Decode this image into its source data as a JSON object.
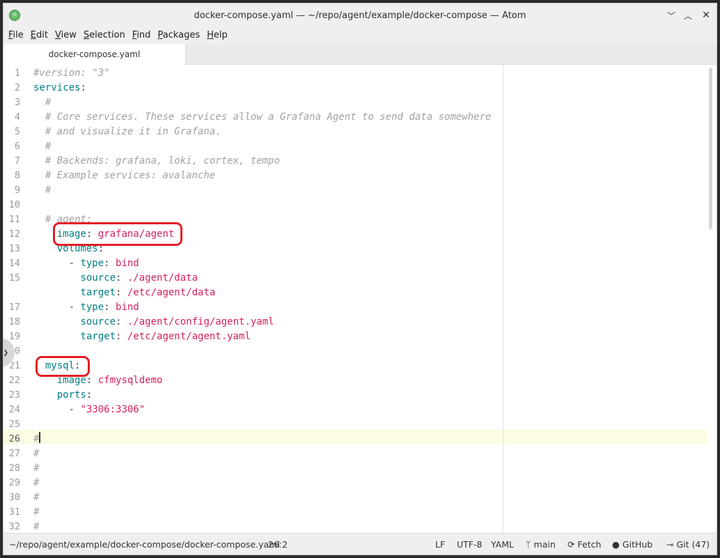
{
  "window": {
    "title": "docker-compose.yaml — ~/repo/agent/example/docker-compose — Atom"
  },
  "menu": [
    {
      "label": "File",
      "mnemonic": "F",
      "rest": "ile"
    },
    {
      "label": "Edit",
      "mnemonic": "E",
      "rest": "dit"
    },
    {
      "label": "View",
      "mnemonic": "V",
      "rest": "iew"
    },
    {
      "label": "Selection",
      "mnemonic": "S",
      "rest": "election"
    },
    {
      "label": "Find",
      "mnemonic": "F",
      "rest": "ind"
    },
    {
      "label": "Packages",
      "mnemonic": "P",
      "rest": "ackages"
    },
    {
      "label": "Help",
      "mnemonic": "H",
      "rest": "elp"
    }
  ],
  "tabs": [
    {
      "label": "docker-compose.yaml",
      "active": true
    }
  ],
  "editor": {
    "active_line": 26,
    "lines": [
      {
        "n": "1",
        "tokens": [
          {
            "t": "comment",
            "v": "#version: \"3\""
          }
        ]
      },
      {
        "n": "2",
        "tokens": [
          {
            "t": "key",
            "v": "services"
          },
          {
            "t": "punct",
            "v": ":"
          }
        ]
      },
      {
        "n": "3",
        "tokens": [
          {
            "t": "comment",
            "v": "  #"
          }
        ]
      },
      {
        "n": "4",
        "tokens": [
          {
            "t": "comment",
            "v": "  # Core services. These services allow a Grafana Agent to send data somewhere"
          }
        ]
      },
      {
        "n": "5",
        "tokens": [
          {
            "t": "comment",
            "v": "  # and visualize it in Grafana."
          }
        ]
      },
      {
        "n": "6",
        "tokens": [
          {
            "t": "comment",
            "v": "  #"
          }
        ]
      },
      {
        "n": "7",
        "tokens": [
          {
            "t": "comment",
            "v": "  # Backends: grafana, loki, cortex, tempo"
          }
        ]
      },
      {
        "n": "8",
        "tokens": [
          {
            "t": "comment",
            "v": "  # Example services: avalanche"
          }
        ]
      },
      {
        "n": "9",
        "tokens": [
          {
            "t": "comment",
            "v": "  #"
          }
        ]
      },
      {
        "n": "10",
        "tokens": []
      },
      {
        "n": "11",
        "tokens": [
          {
            "t": "comment",
            "v": "  # agent:"
          }
        ]
      },
      {
        "n": "12",
        "tokens": [
          {
            "t": "plain",
            "v": "    "
          },
          {
            "t": "key",
            "v": "image"
          },
          {
            "t": "punct",
            "v": ": "
          },
          {
            "t": "str",
            "v": "grafana/agent"
          }
        ]
      },
      {
        "n": "13",
        "tokens": [
          {
            "t": "plain",
            "v": "    "
          },
          {
            "t": "key",
            "v": "volumes"
          },
          {
            "t": "punct",
            "v": ":"
          }
        ]
      },
      {
        "n": "14",
        "tokens": [
          {
            "t": "plain",
            "v": "      - "
          },
          {
            "t": "key",
            "v": "type"
          },
          {
            "t": "punct",
            "v": ": "
          },
          {
            "t": "str",
            "v": "bind"
          }
        ]
      },
      {
        "n": "15",
        "tokens": [
          {
            "t": "plain",
            "v": "        "
          },
          {
            "t": "key",
            "v": "source"
          },
          {
            "t": "punct",
            "v": ": "
          },
          {
            "t": "str",
            "v": "./agent/data"
          }
        ]
      },
      {
        "n": "",
        "tokens": [
          {
            "t": "plain",
            "v": "        "
          },
          {
            "t": "key",
            "v": "target"
          },
          {
            "t": "punct",
            "v": ": "
          },
          {
            "t": "str",
            "v": "/etc/agent/data"
          }
        ]
      },
      {
        "n": "17",
        "tokens": [
          {
            "t": "plain",
            "v": "      - "
          },
          {
            "t": "key",
            "v": "type"
          },
          {
            "t": "punct",
            "v": ": "
          },
          {
            "t": "str",
            "v": "bind"
          }
        ]
      },
      {
        "n": "18",
        "tokens": [
          {
            "t": "plain",
            "v": "        "
          },
          {
            "t": "key",
            "v": "source"
          },
          {
            "t": "punct",
            "v": ": "
          },
          {
            "t": "str",
            "v": "./agent/config/agent.yaml"
          }
        ]
      },
      {
        "n": "19",
        "tokens": [
          {
            "t": "plain",
            "v": "        "
          },
          {
            "t": "key",
            "v": "target"
          },
          {
            "t": "punct",
            "v": ": "
          },
          {
            "t": "str",
            "v": "/etc/agent/agent.yaml"
          }
        ]
      },
      {
        "n": "20",
        "tokens": []
      },
      {
        "n": "21",
        "tokens": [
          {
            "t": "plain",
            "v": "  "
          },
          {
            "t": "key",
            "v": "mysql"
          },
          {
            "t": "punct",
            "v": ":"
          }
        ]
      },
      {
        "n": "22",
        "tokens": [
          {
            "t": "plain",
            "v": "    "
          },
          {
            "t": "key",
            "v": "image"
          },
          {
            "t": "punct",
            "v": ": "
          },
          {
            "t": "str",
            "v": "cfmysqldemo"
          }
        ]
      },
      {
        "n": "23",
        "tokens": [
          {
            "t": "plain",
            "v": "    "
          },
          {
            "t": "key",
            "v": "ports"
          },
          {
            "t": "punct",
            "v": ":"
          }
        ]
      },
      {
        "n": "24",
        "tokens": [
          {
            "t": "plain",
            "v": "      - "
          },
          {
            "t": "str",
            "v": "\"3306:3306\""
          }
        ]
      },
      {
        "n": "25",
        "tokens": []
      },
      {
        "n": "26",
        "tokens": [
          {
            "t": "comment",
            "v": "#"
          }
        ]
      },
      {
        "n": "27",
        "tokens": [
          {
            "t": "comment",
            "v": "#"
          }
        ]
      },
      {
        "n": "28",
        "tokens": [
          {
            "t": "comment",
            "v": "#"
          }
        ]
      },
      {
        "n": "29",
        "tokens": [
          {
            "t": "comment",
            "v": "#"
          }
        ]
      },
      {
        "n": "30",
        "tokens": [
          {
            "t": "comment",
            "v": "#"
          }
        ]
      },
      {
        "n": "31",
        "tokens": [
          {
            "t": "comment",
            "v": "#"
          }
        ]
      },
      {
        "n": "32",
        "tokens": [
          {
            "t": "comment",
            "v": "#"
          }
        ]
      }
    ]
  },
  "status": {
    "path": "~/repo/agent/example/docker-compose/docker-compose.yaml",
    "cursor": "26:2",
    "line_ending": "LF",
    "encoding": "UTF-8",
    "grammar": "YAML",
    "branch": "main",
    "fetch": "Fetch",
    "github": "GitHub",
    "git": "Git (47)"
  },
  "colors": {
    "highlight_box": "#e31d25",
    "key": "#007f83",
    "string": "#d6205b",
    "comment": "#a0a1a7",
    "active_line": "#fcfbe3"
  },
  "icons": {
    "app": "atom-icon",
    "branch": "git-branch-icon",
    "fetch": "sync-icon",
    "github": "github-icon",
    "git": "git-commit-icon"
  }
}
